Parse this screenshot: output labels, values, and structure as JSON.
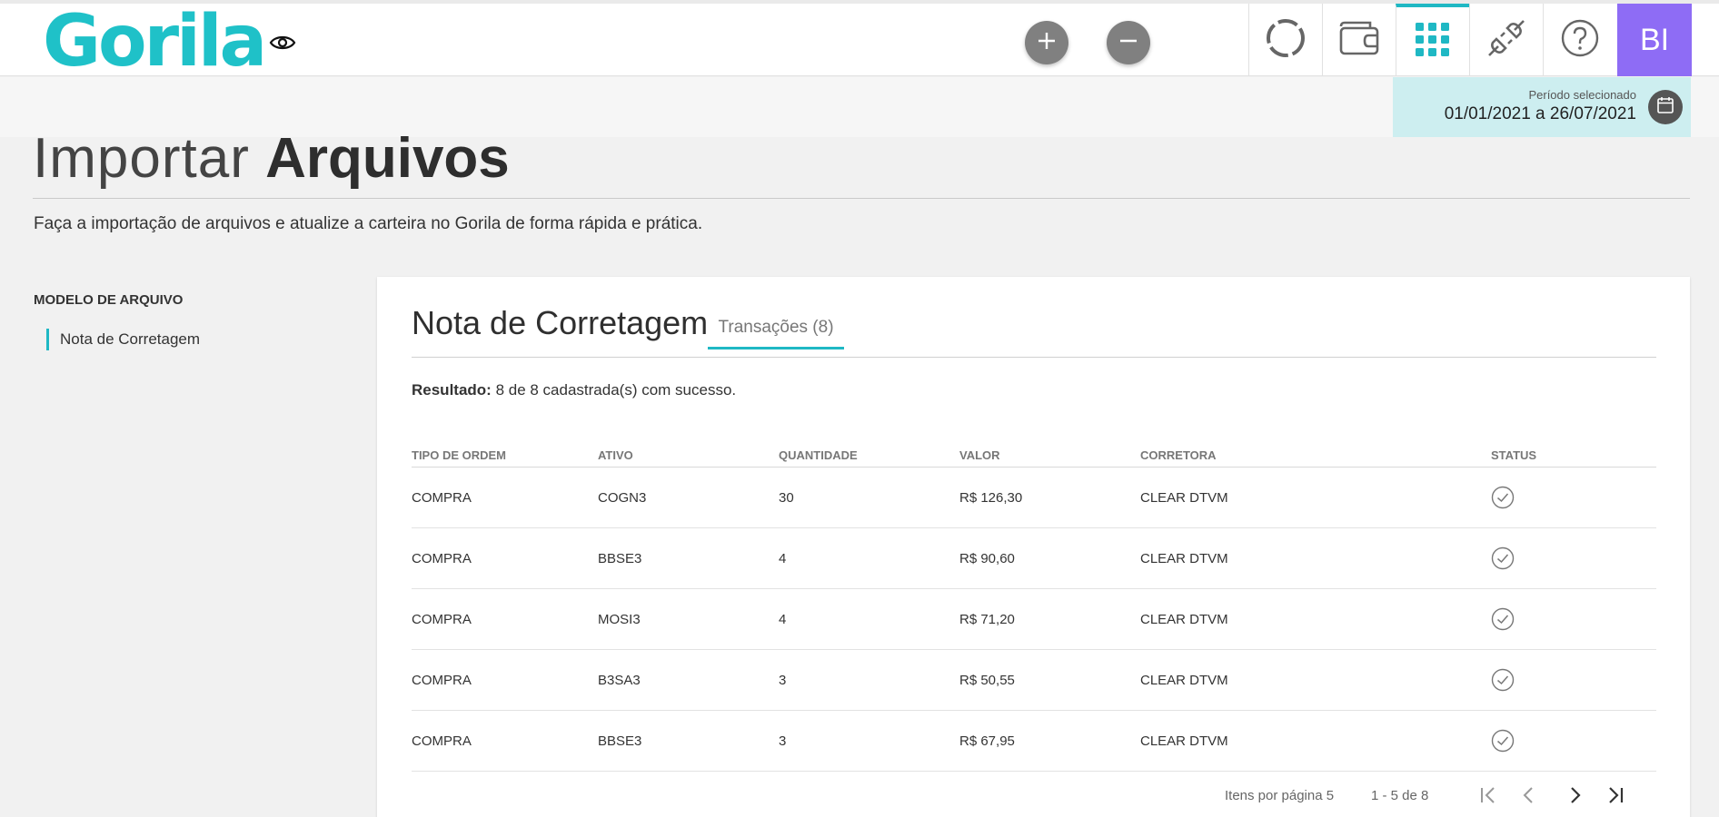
{
  "brand": {
    "logo_text": "Gorila",
    "accent": "#1fc1c8"
  },
  "header": {
    "visibility_icon": "eye-icon",
    "add_icon": "plus-icon",
    "remove_icon": "minus-icon",
    "nav": [
      {
        "icon": "sync-circle-icon",
        "active": false
      },
      {
        "icon": "wallet-icon",
        "active": false
      },
      {
        "icon": "apps-grid-icon",
        "active": true
      },
      {
        "icon": "plug-icon",
        "active": false
      },
      {
        "icon": "help-icon",
        "active": false
      }
    ],
    "avatar_initials": "BI",
    "avatar_color": "#8e6cf5"
  },
  "period": {
    "label": "Período selecionado",
    "value": "01/01/2021 a 26/07/2021",
    "icon": "calendar-icon"
  },
  "page": {
    "title_light": "Importar",
    "title_bold": "Arquivos",
    "description": "Faça a importação de arquivos e atualize a carteira no Gorila de forma rápida e prática."
  },
  "sidebar": {
    "heading": "MODELO DE ARQUIVO",
    "items": [
      {
        "label": "Nota de Corretagem",
        "active": true
      }
    ]
  },
  "card": {
    "title": "Nota de Corretagem",
    "tab_label": "Transações (8)",
    "result_label": "Resultado:",
    "result_text": " 8 de 8 cadastrada(s) com sucesso."
  },
  "table": {
    "columns": [
      "TIPO DE ORDEM",
      "ATIVO",
      "QUANTIDADE",
      "VALOR",
      "CORRETORA",
      "STATUS"
    ],
    "rows": [
      {
        "tipo": "COMPRA",
        "ativo": "COGN3",
        "quantidade": "30",
        "valor": "R$ 126,30",
        "corretora": "CLEAR DTVM",
        "status": "check-circle-icon"
      },
      {
        "tipo": "COMPRA",
        "ativo": "BBSE3",
        "quantidade": "4",
        "valor": "R$ 90,60",
        "corretora": "CLEAR DTVM",
        "status": "check-circle-icon"
      },
      {
        "tipo": "COMPRA",
        "ativo": "MOSI3",
        "quantidade": "4",
        "valor": "R$ 71,20",
        "corretora": "CLEAR DTVM",
        "status": "check-circle-icon"
      },
      {
        "tipo": "COMPRA",
        "ativo": "B3SA3",
        "quantidade": "3",
        "valor": "R$ 50,55",
        "corretora": "CLEAR DTVM",
        "status": "check-circle-icon"
      },
      {
        "tipo": "COMPRA",
        "ativo": "BBSE3",
        "quantidade": "3",
        "valor": "R$ 67,95",
        "corretora": "CLEAR DTVM",
        "status": "check-circle-icon"
      }
    ]
  },
  "pagination": {
    "items_per_page_label": "Itens por página 5",
    "range_label": "1 - 5 de 8"
  }
}
